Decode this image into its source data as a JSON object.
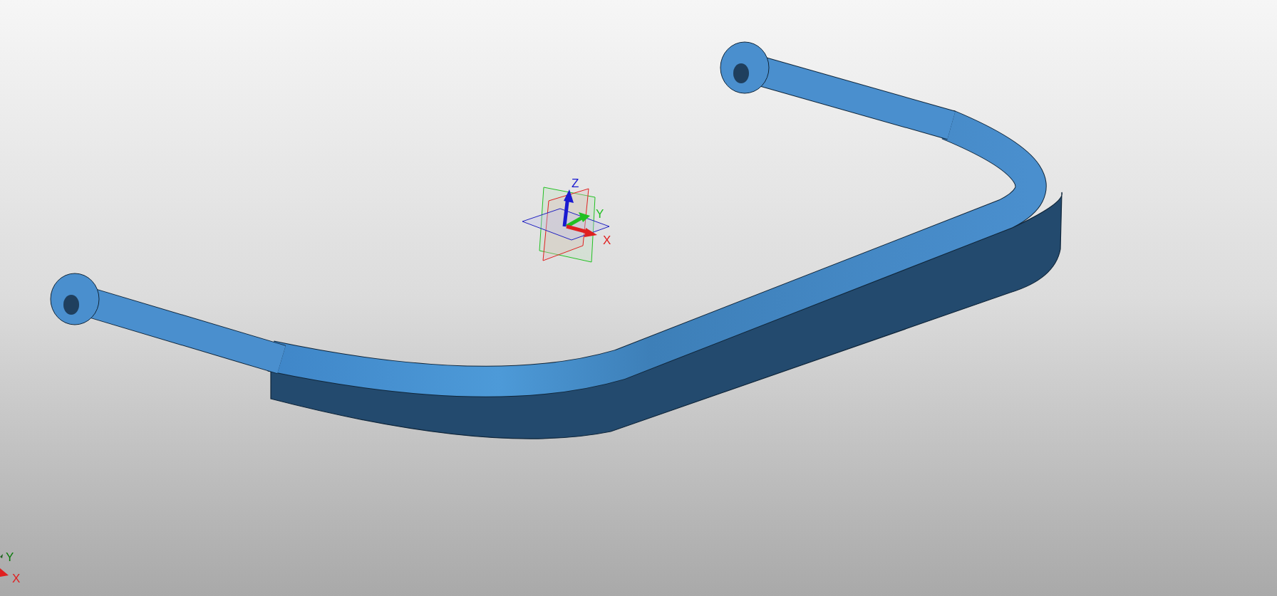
{
  "viewport": {
    "triad": {
      "axes": [
        {
          "label": "Z",
          "color": "#1a1ad0"
        },
        {
          "label": "Y",
          "color": "#22c022"
        },
        {
          "label": "X",
          "color": "#e02020"
        }
      ]
    },
    "corner_triad": {
      "axes": [
        {
          "label": "Y",
          "color": "#0a7a0a"
        },
        {
          "label": "X",
          "color": "#e02020"
        }
      ]
    }
  }
}
